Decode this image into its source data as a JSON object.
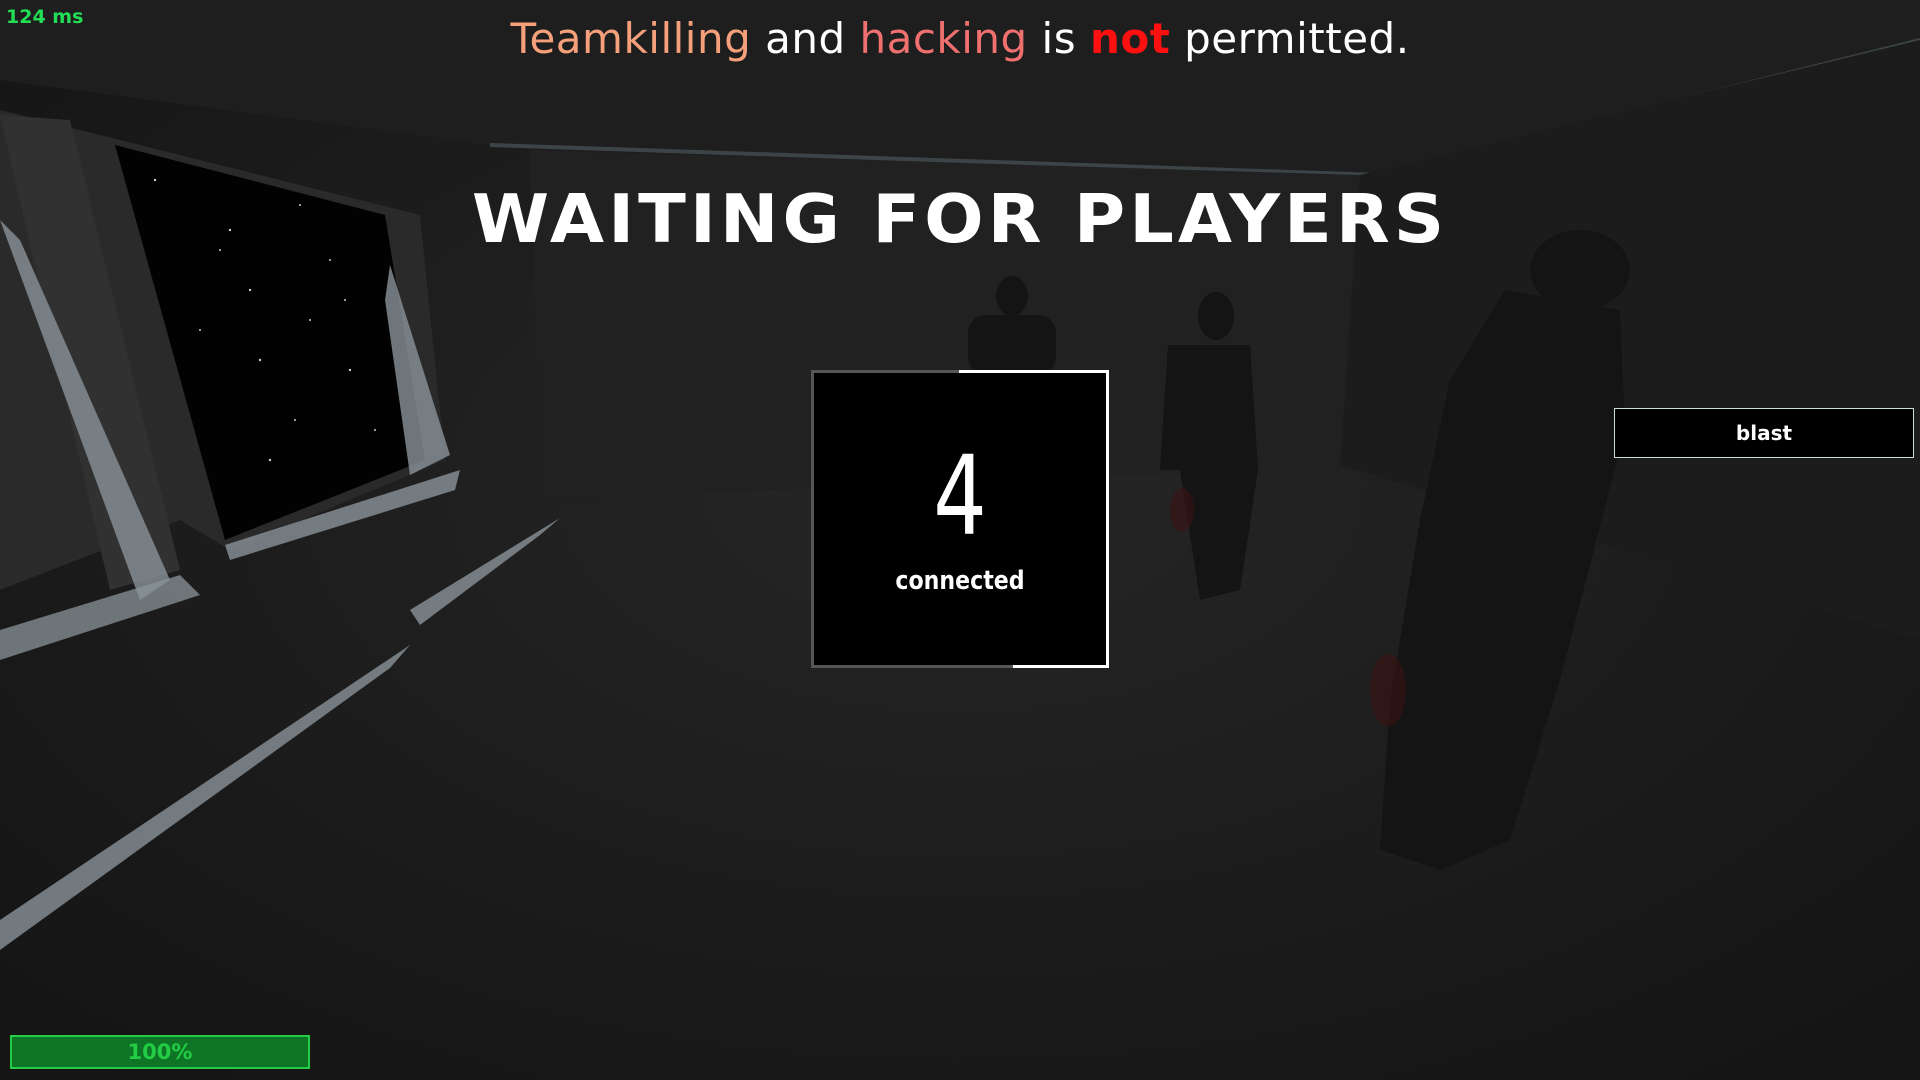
{
  "hud": {
    "ping": "124 ms"
  },
  "rules_banner": {
    "w1": "Teamkilling",
    "w2": " and ",
    "w3": "hacking",
    "w4": " is ",
    "w5": "not",
    "w6": " permitted."
  },
  "lobby": {
    "title": "WAITING FOR PLAYERS",
    "connected_count": "4",
    "connected_label": "connected"
  },
  "players": {
    "name": "blast"
  },
  "loading": {
    "progress_text": "100%",
    "progress_fraction": 1.0
  },
  "colors": {
    "ping": "#22dd55",
    "teamkilling": "#f5a07a",
    "hacking": "#f07070",
    "not": "#ff1010",
    "progress": "#22cc44"
  }
}
